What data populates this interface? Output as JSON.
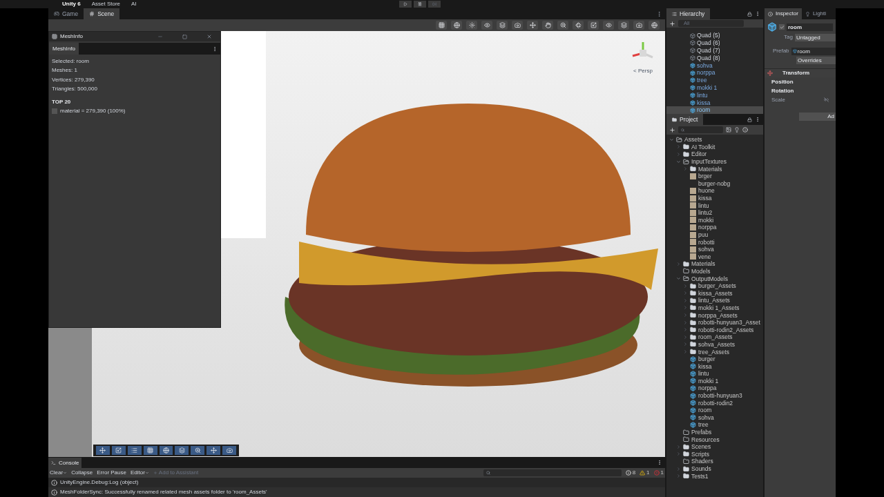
{
  "top_bar": {
    "title": "Unity 6",
    "menus": [
      "Asset Store",
      "AI"
    ]
  },
  "scene_tabs": [
    {
      "label": "Game",
      "kind": "game",
      "selected": false
    },
    {
      "label": "Scene",
      "kind": "scene",
      "selected": true
    }
  ],
  "viewport": {
    "projection": "< Persp"
  },
  "meshinfo": {
    "title": "MeshInfo",
    "tab": "MeshInfo",
    "lines": [
      "Selected: room",
      "Meshes: 1",
      "Vertices: 279,390",
      "Triangles: 500,000"
    ],
    "heading": "TOP 20",
    "materials": [
      "material = 279,390 (100%)"
    ]
  },
  "hierarchy": {
    "title": "Hierarchy",
    "search_placeholder": "All",
    "items": [
      {
        "label": "Quad (5)",
        "kind": "object",
        "selected": false
      },
      {
        "label": "Quad (6)",
        "kind": "object",
        "selected": false
      },
      {
        "label": "Quad (7)",
        "kind": "object",
        "selected": false
      },
      {
        "label": "Quad (8)",
        "kind": "object",
        "selected": false
      },
      {
        "label": "sohva",
        "kind": "prefab",
        "selected": false
      },
      {
        "label": "norppa",
        "kind": "prefab",
        "selected": false
      },
      {
        "label": "tree",
        "kind": "prefab",
        "selected": false
      },
      {
        "label": "mokki 1",
        "kind": "prefab",
        "selected": false
      },
      {
        "label": "lintu",
        "kind": "prefab",
        "selected": false
      },
      {
        "label": "kissa",
        "kind": "prefab",
        "selected": false
      },
      {
        "label": "room",
        "kind": "prefab",
        "selected": true
      }
    ]
  },
  "inspector": {
    "tabs": [
      {
        "label": "Inspector",
        "selected": true
      },
      {
        "label": "Lighti",
        "selected": false
      }
    ],
    "name": "room",
    "active": true,
    "tag_label": "Tag",
    "tag": "Untagged",
    "prefab_label": "Prefab",
    "prefab": "room",
    "overrides": "Overrides",
    "component": "Transform",
    "fields": [
      "Position",
      "Rotation",
      "Scale"
    ],
    "button": "Ad"
  },
  "project": {
    "title": "Project",
    "tree": [
      {
        "label": "Assets",
        "kind": "folder",
        "expanded": true,
        "children": [
          {
            "label": "AI Toolkit",
            "kind": "folder",
            "expanded": false
          },
          {
            "label": "Editor",
            "kind": "folder",
            "expanded": false
          },
          {
            "label": "InputTextures",
            "kind": "folder",
            "expanded": true,
            "children": [
              {
                "label": "Materials",
                "kind": "folder",
                "expanded": false
              },
              {
                "label": "brger",
                "kind": "texture"
              },
              {
                "label": "burger-nobg",
                "kind": "file"
              },
              {
                "label": "huone",
                "kind": "texture"
              },
              {
                "label": "kissa",
                "kind": "texture"
              },
              {
                "label": "lintu",
                "kind": "texture"
              },
              {
                "label": "lintu2",
                "kind": "texture"
              },
              {
                "label": "mokki",
                "kind": "texture"
              },
              {
                "label": "norppa",
                "kind": "texture"
              },
              {
                "label": "puu",
                "kind": "texture"
              },
              {
                "label": "robotti",
                "kind": "texture"
              },
              {
                "label": "sohva",
                "kind": "texture"
              },
              {
                "label": "vene",
                "kind": "texture"
              }
            ]
          },
          {
            "label": "Materials",
            "kind": "folder",
            "expanded": false
          },
          {
            "label": "Models",
            "kind": "empty_folder"
          },
          {
            "label": "OutputModels",
            "kind": "folder",
            "expanded": true,
            "children": [
              {
                "label": "burger_Assets",
                "kind": "folder",
                "expanded": false
              },
              {
                "label": "kissa_Assets",
                "kind": "folder",
                "expanded": false
              },
              {
                "label": "lintu_Assets",
                "kind": "folder",
                "expanded": false
              },
              {
                "label": "mokki 1_Assets",
                "kind": "folder",
                "expanded": false
              },
              {
                "label": "norppa_Assets",
                "kind": "folder",
                "expanded": false
              },
              {
                "label": "robotti-hunyuan3_Asset",
                "kind": "folder",
                "expanded": false
              },
              {
                "label": "robotti-rodin2_Assets",
                "kind": "folder",
                "expanded": false
              },
              {
                "label": "room_Assets",
                "kind": "folder",
                "expanded": false
              },
              {
                "label": "sohva_Assets",
                "kind": "folder",
                "expanded": false
              },
              {
                "label": "tree_Assets",
                "kind": "folder",
                "expanded": false
              },
              {
                "label": "burger",
                "kind": "prefab"
              },
              {
                "label": "kissa",
                "kind": "prefab"
              },
              {
                "label": "lintu",
                "kind": "prefab"
              },
              {
                "label": "mokki 1",
                "kind": "prefab"
              },
              {
                "label": "norppa",
                "kind": "prefab"
              },
              {
                "label": "robotti-hunyuan3",
                "kind": "prefab"
              },
              {
                "label": "robotti-rodin2",
                "kind": "prefab"
              },
              {
                "label": "room",
                "kind": "prefab"
              },
              {
                "label": "sohva",
                "kind": "prefab"
              },
              {
                "label": "tree",
                "kind": "prefab"
              }
            ]
          },
          {
            "label": "Prefabs",
            "kind": "empty_folder"
          },
          {
            "label": "Resources",
            "kind": "empty_folder"
          },
          {
            "label": "Scenes",
            "kind": "folder",
            "expanded": false
          },
          {
            "label": "Scripts",
            "kind": "folder",
            "expanded": false
          },
          {
            "label": "Shaders",
            "kind": "empty_folder"
          },
          {
            "label": "Sounds",
            "kind": "folder",
            "expanded": false
          },
          {
            "label": "Tests1",
            "kind": "folder",
            "expanded": false
          }
        ]
      }
    ]
  },
  "console": {
    "title": "Console",
    "toolbar": [
      "Clear",
      "Collapse",
      "Error Pause",
      "Editor"
    ],
    "assistant": "Add to Assistant",
    "counts": [
      {
        "kind": "log",
        "count": "8"
      },
      {
        "kind": "warning",
        "count": "1"
      },
      {
        "kind": "error",
        "count": "1"
      }
    ],
    "messages": [
      "UnityEngine.Debug:Log (object)",
      "MeshFolderSync: Successfully renamed related mesh assets folder to 'room_Assets'"
    ]
  }
}
